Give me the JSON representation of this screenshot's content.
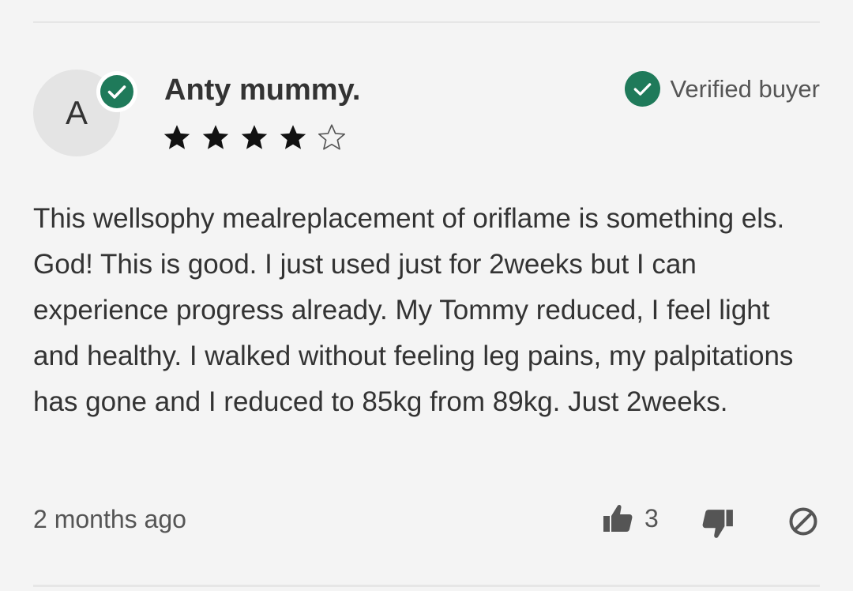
{
  "review": {
    "avatar_initial": "A",
    "reviewer_name": "Anty mummy.",
    "rating": 4,
    "rating_max": 5,
    "verified_label": "Verified buyer",
    "text": "This wellsophy mealreplacement of oriflame is something els. God! This is good. I just used just for 2weeks but I can experience progress already. My Tommy reduced, I feel light and healthy. I walked without feeling leg pains, my palpitations has gone and I reduced to 85kg from 89kg. Just 2weeks.",
    "posted": "2 months ago",
    "helpful_count": "3"
  },
  "icons": {
    "avatar_badge": "check-circle-icon",
    "verified": "check-circle-icon",
    "helpful": "thumbs-up-icon",
    "not_helpful": "thumbs-down-icon",
    "report": "block-icon",
    "star_filled": "star-filled-icon",
    "star_empty": "star-outline-icon"
  },
  "colors": {
    "background": "#f4f4f4",
    "verified_green": "#1f7a5a",
    "text": "#333333",
    "muted_text": "#555555",
    "star": "#111111"
  }
}
